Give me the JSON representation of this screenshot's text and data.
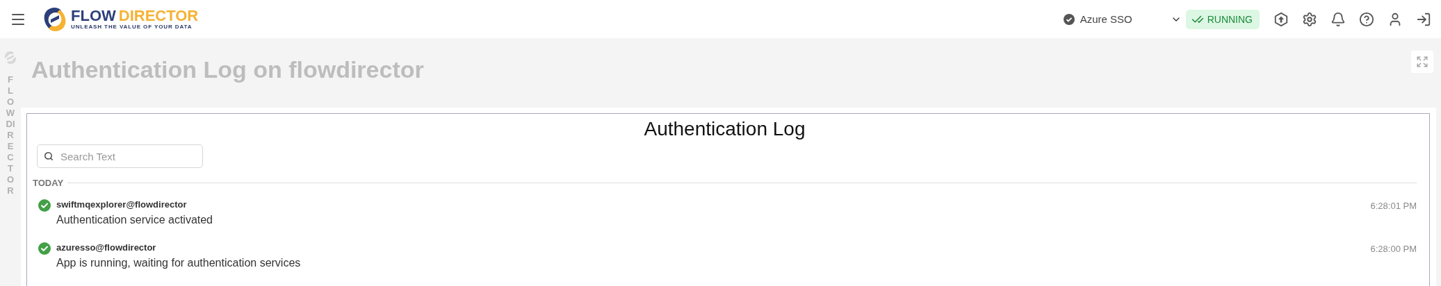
{
  "header": {
    "logo": {
      "word_1": "FLOW",
      "word_2": "DIRECTOR",
      "tagline": "UNLEASH THE VALUE OF YOUR DATA"
    },
    "auth_selector": {
      "label": "Azure SSO"
    },
    "status": {
      "label": "RUNNING",
      "running": true
    }
  },
  "rail": {
    "label": "FLOWDIRECTOR"
  },
  "page": {
    "title": "Authentication Log on flowdirector"
  },
  "log": {
    "title": "Authentication Log",
    "search": {
      "placeholder": "Search Text"
    },
    "groups": [
      {
        "label": "TODAY",
        "entries": [
          {
            "user": "swiftmqexplorer@flowdirector",
            "message": "Authentication service activated",
            "time": "6:28:01 PM",
            "ok": true
          },
          {
            "user": "azuresso@flowdirector",
            "message": "App is running, waiting for authentication services",
            "time": "6:28:00 PM",
            "ok": true
          }
        ]
      }
    ]
  }
}
